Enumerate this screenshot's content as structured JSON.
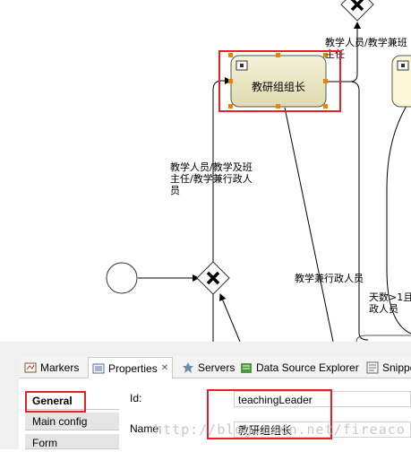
{
  "diagram": {
    "task_name": "教研组组长",
    "label_top_right": "教学人员/教学兼班\n主任",
    "label_left": "教学人员/教学及班\n主任/教学兼行政人\n员",
    "label_middle": "教学兼行政人员",
    "label_bottom_right": "天数>1且\n政人员"
  },
  "tabs": [
    {
      "label": "Markers",
      "icon": "markers-icon"
    },
    {
      "label": "Properties",
      "icon": "properties-icon",
      "close": "✕"
    },
    {
      "label": "Servers",
      "icon": "servers-icon"
    },
    {
      "label": "Data Source Explorer",
      "icon": "data-source-icon"
    },
    {
      "label": "Snippe",
      "icon": "snippets-icon"
    }
  ],
  "sections": [
    "General",
    "Main config",
    "Form"
  ],
  "fields": {
    "id_label": "Id:",
    "id_value": "teachingLeader",
    "name_label": "Name:",
    "name_value": "教研组组长"
  },
  "watermark": "http://blog.csdn.net/fireaco"
}
